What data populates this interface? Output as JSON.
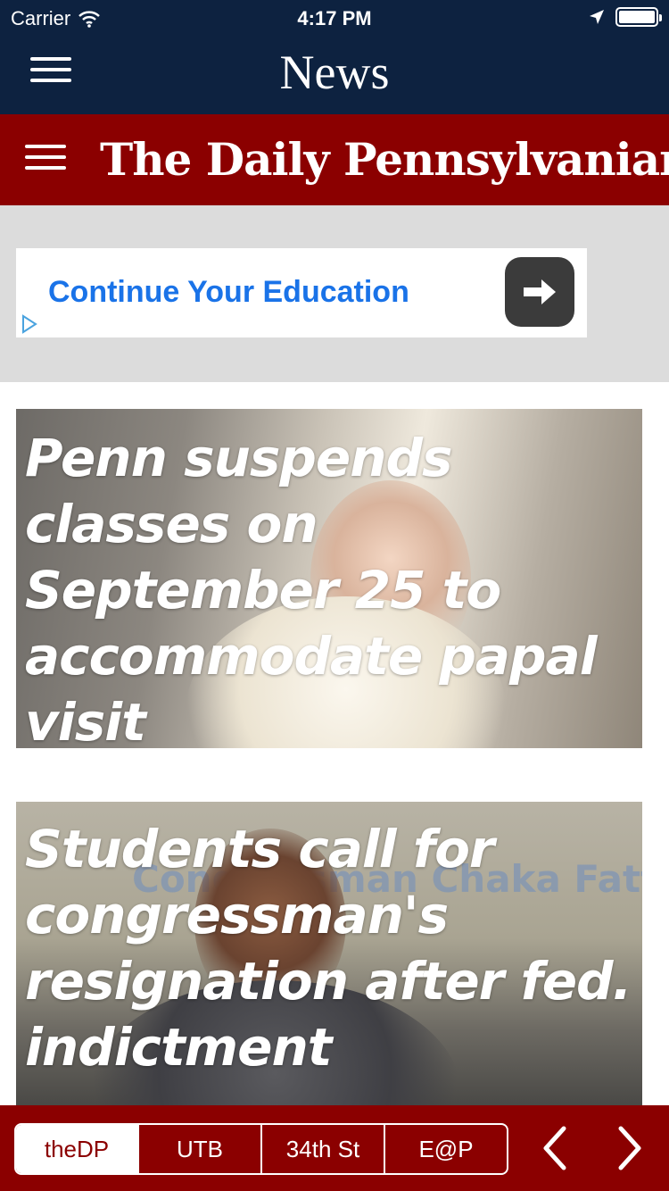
{
  "status": {
    "carrier": "Carrier",
    "time": "4:17 PM"
  },
  "navbar": {
    "title": "News",
    "menu_icon": "hamburger-icon"
  },
  "masthead": {
    "title": "The Daily Pennsylvanian",
    "menu_icon": "hamburger-icon"
  },
  "ad": {
    "text": "Continue Your Education",
    "arrow_icon": "arrow-right-icon",
    "choice_icon": "adchoices-icon",
    "link_color": "#1a73e8"
  },
  "articles": [
    {
      "title": "Penn suspends classes on September 25 to accommodate papal visit"
    },
    {
      "title": "Students call for congressman's resignation after fed. indictment",
      "photo_sign_text": "Congressman Chaka Fatta"
    }
  ],
  "tabs": [
    {
      "label": "theDP",
      "selected": true
    },
    {
      "label": "UTB",
      "selected": false
    },
    {
      "label": "34th St",
      "selected": false
    },
    {
      "label": "E@P",
      "selected": false
    }
  ],
  "colors": {
    "nav_bg": "#0d2240",
    "brand_red": "#8b0000",
    "ad_bg": "#dcdcdc"
  }
}
